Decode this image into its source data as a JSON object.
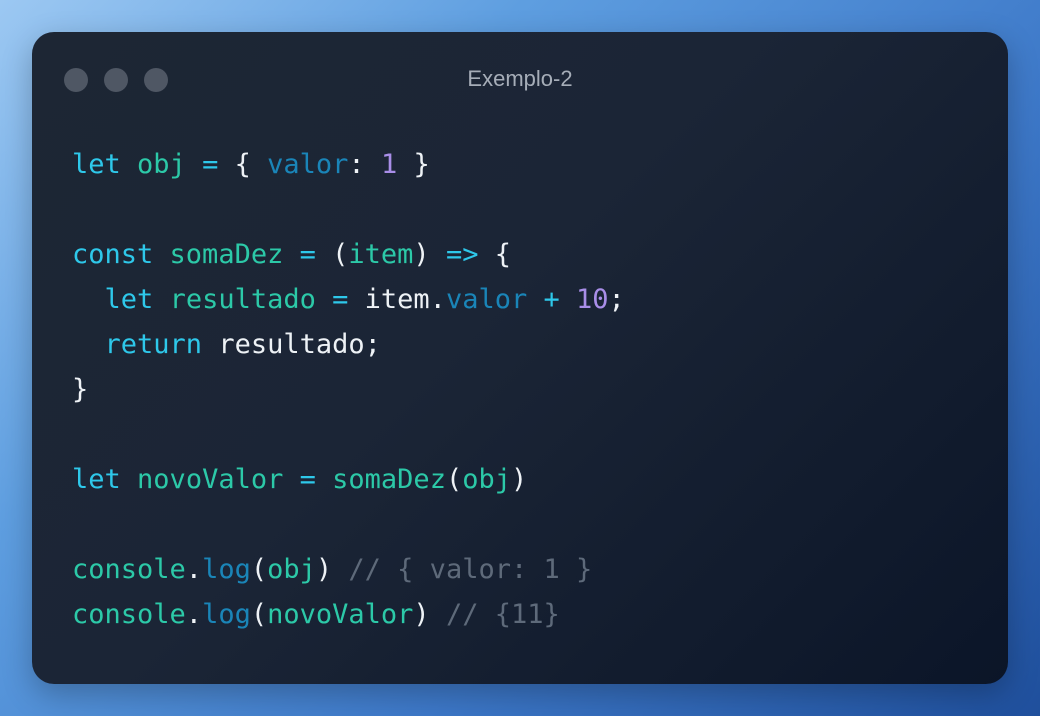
{
  "window": {
    "title": "Exemplo-2",
    "buttons": [
      "close",
      "minimize",
      "maximize"
    ]
  },
  "colors": {
    "keyword": "#2ec8ea",
    "identifier": "#2cc9a8",
    "property": "#1a85b8",
    "number": "#a98ee8",
    "plain": "#eef2f6",
    "comment": "#5e6a7a"
  },
  "code": {
    "lines": [
      [
        [
          "kw",
          "let"
        ],
        [
          "pl",
          " "
        ],
        [
          "id",
          "obj"
        ],
        [
          "pl",
          " "
        ],
        [
          "op",
          "="
        ],
        [
          "pl",
          " { "
        ],
        [
          "prop",
          "valor"
        ],
        [
          "pl",
          ": "
        ],
        [
          "num",
          "1"
        ],
        [
          "pl",
          " }"
        ]
      ],
      [],
      [
        [
          "kw",
          "const"
        ],
        [
          "pl",
          " "
        ],
        [
          "id",
          "somaDez"
        ],
        [
          "pl",
          " "
        ],
        [
          "op",
          "="
        ],
        [
          "pl",
          " ("
        ],
        [
          "id",
          "item"
        ],
        [
          "pl",
          ") "
        ],
        [
          "op",
          "=>"
        ],
        [
          "pl",
          " {"
        ]
      ],
      [
        [
          "pl",
          "  "
        ],
        [
          "kw",
          "let"
        ],
        [
          "pl",
          " "
        ],
        [
          "id",
          "resultado"
        ],
        [
          "pl",
          " "
        ],
        [
          "op",
          "="
        ],
        [
          "pl",
          " item."
        ],
        [
          "prop",
          "valor"
        ],
        [
          "pl",
          " "
        ],
        [
          "op",
          "+"
        ],
        [
          "pl",
          " "
        ],
        [
          "num",
          "10"
        ],
        [
          "pl",
          ";"
        ]
      ],
      [
        [
          "pl",
          "  "
        ],
        [
          "kw",
          "return"
        ],
        [
          "pl",
          " resultado;"
        ]
      ],
      [
        [
          "pl",
          "}"
        ]
      ],
      [],
      [
        [
          "kw",
          "let"
        ],
        [
          "pl",
          " "
        ],
        [
          "id",
          "novoValor"
        ],
        [
          "pl",
          " "
        ],
        [
          "op",
          "="
        ],
        [
          "pl",
          " "
        ],
        [
          "id",
          "somaDez"
        ],
        [
          "pl",
          "("
        ],
        [
          "id",
          "obj"
        ],
        [
          "pl",
          ")"
        ]
      ],
      [],
      [
        [
          "id",
          "console"
        ],
        [
          "pl",
          "."
        ],
        [
          "prop",
          "log"
        ],
        [
          "pl",
          "("
        ],
        [
          "id",
          "obj"
        ],
        [
          "pl",
          ") "
        ],
        [
          "cm",
          "// { valor: 1 }"
        ]
      ],
      [
        [
          "id",
          "console"
        ],
        [
          "pl",
          "."
        ],
        [
          "prop",
          "log"
        ],
        [
          "pl",
          "("
        ],
        [
          "id",
          "novoValor"
        ],
        [
          "pl",
          ") "
        ],
        [
          "cm",
          "// {11}"
        ]
      ]
    ]
  }
}
